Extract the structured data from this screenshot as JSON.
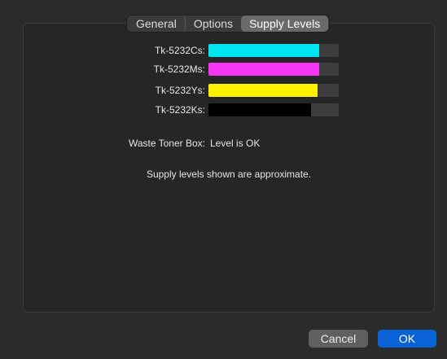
{
  "tabs": [
    {
      "label": "General",
      "selected": false
    },
    {
      "label": "Options",
      "selected": false
    },
    {
      "label": "Supply Levels",
      "selected": true
    }
  ],
  "supplies": [
    {
      "label": "Tk-5232Cs:",
      "color": "#00e5ef",
      "level_percent": 85
    },
    {
      "label": "Tk-5232Ms:",
      "color": "#f436f2",
      "level_percent": 85
    },
    {
      "label": "Tk-5232Ys:",
      "color": "#fff200",
      "level_percent": 84
    },
    {
      "label": "Tk-5232Ks:",
      "color": "#000000",
      "level_percent": 79
    }
  ],
  "waste": {
    "label": "Waste Toner Box:",
    "value": "Level is OK"
  },
  "note": "Supply levels shown are approximate.",
  "buttons": {
    "cancel": "Cancel",
    "ok": "OK"
  },
  "colors": {
    "accent": "#0a63d6",
    "bar_track": "#3d3d3d"
  }
}
